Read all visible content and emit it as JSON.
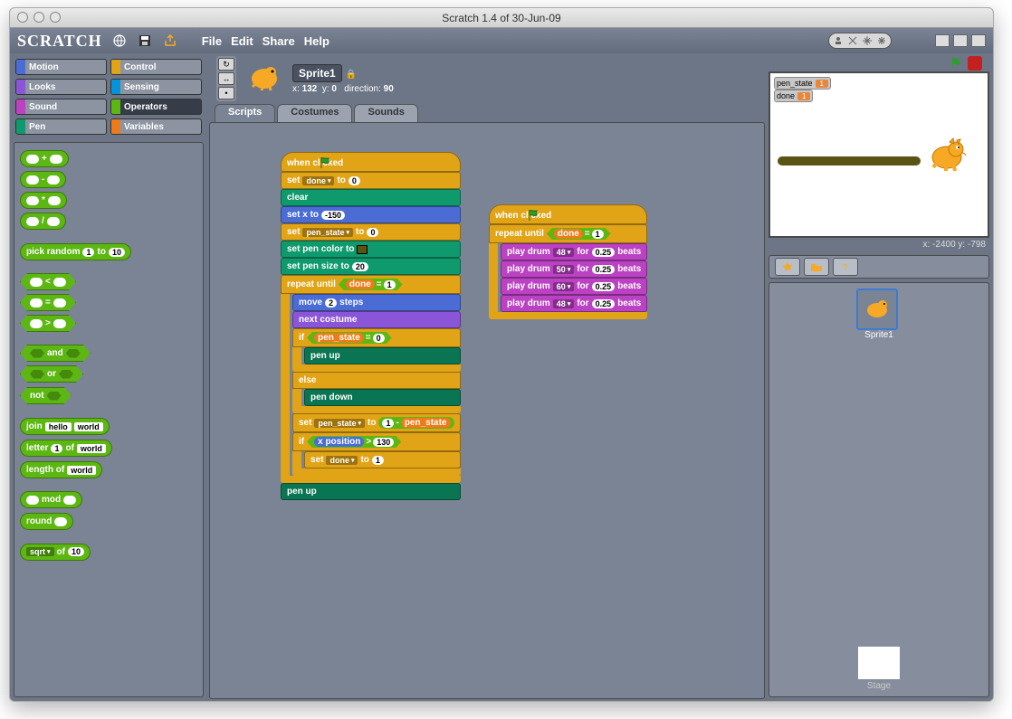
{
  "window": {
    "title": "Scratch 1.4 of 30-Jun-09"
  },
  "logo": "SCRATCH",
  "menu": [
    "File",
    "Edit",
    "Share",
    "Help"
  ],
  "categories": [
    {
      "name": "Motion",
      "color": "#4a6cd4",
      "selected": false
    },
    {
      "name": "Control",
      "color": "#e1a416",
      "selected": false
    },
    {
      "name": "Looks",
      "color": "#8a55d7",
      "selected": false
    },
    {
      "name": "Sensing",
      "color": "#0494dc",
      "selected": false
    },
    {
      "name": "Sound",
      "color": "#bb42c3",
      "selected": false
    },
    {
      "name": "Operators",
      "color": "#5cb712",
      "selected": true
    },
    {
      "name": "Pen",
      "color": "#0e9a6c",
      "selected": false
    },
    {
      "name": "Variables",
      "color": "#ee7b1a",
      "selected": false
    }
  ],
  "palette": {
    "ops_plus": "+",
    "ops_minus": "-",
    "ops_times": "*",
    "ops_div": "/",
    "pick_random": "pick random",
    "to": "to",
    "r_from": "1",
    "r_to": "10",
    "lt": "<",
    "eq": "=",
    "gt": ">",
    "and": "and",
    "or": "or",
    "not": "not",
    "join": "join",
    "hello": "hello",
    "world": "world",
    "letter": "letter",
    "of": "of",
    "letter_n": "1",
    "letter_w": "world",
    "length_of": "length of",
    "length_w": "world",
    "mod": "mod",
    "round": "round",
    "sqrt": "sqrt",
    "sqrt_of": "of",
    "sqrt_n": "10"
  },
  "sprite": {
    "name": "Sprite1",
    "x_label": "x:",
    "x": "132",
    "y_label": "y:",
    "y": "0",
    "dir_label": "direction:",
    "dir": "90"
  },
  "tabs": {
    "scripts": "Scripts",
    "costumes": "Costumes",
    "sounds": "Sounds"
  },
  "script1": {
    "when_clicked": "when        clicked",
    "set": "set",
    "done": "done",
    "to": "to",
    "zero": "0",
    "clear": "clear",
    "set_x_to": "set x to",
    "x_val": "-150",
    "pen_state": "pen_state",
    "set_pen_color_to": "set pen color to",
    "set_pen_size_to": "set pen size to",
    "pen_size": "20",
    "repeat_until": "repeat until",
    "one": "1",
    "move": "move",
    "two": "2",
    "steps": "steps",
    "next_costume": "next costume",
    "if": "if",
    "else": "else",
    "pen_up": "pen up",
    "pen_down": "pen down",
    "minus": "-",
    "x_position": "x position",
    "gt": ">",
    "xlim": "130"
  },
  "script2": {
    "when_clicked": "when        clicked",
    "repeat_until": "repeat until",
    "done": "done",
    "eq": "=",
    "one": "1",
    "play_drum": "play drum",
    "for": "for",
    "beats": "beats",
    "d1": "48",
    "d2": "50",
    "d3": "60",
    "d4": "48",
    "dur": "0.25"
  },
  "stage": {
    "mon1_label": "pen_state",
    "mon1_val": "1",
    "mon2_label": "done",
    "mon2_val": "1",
    "coords": "x: -2400 y: -798"
  },
  "stage_item": "Stage",
  "sprite_item": "Sprite1"
}
